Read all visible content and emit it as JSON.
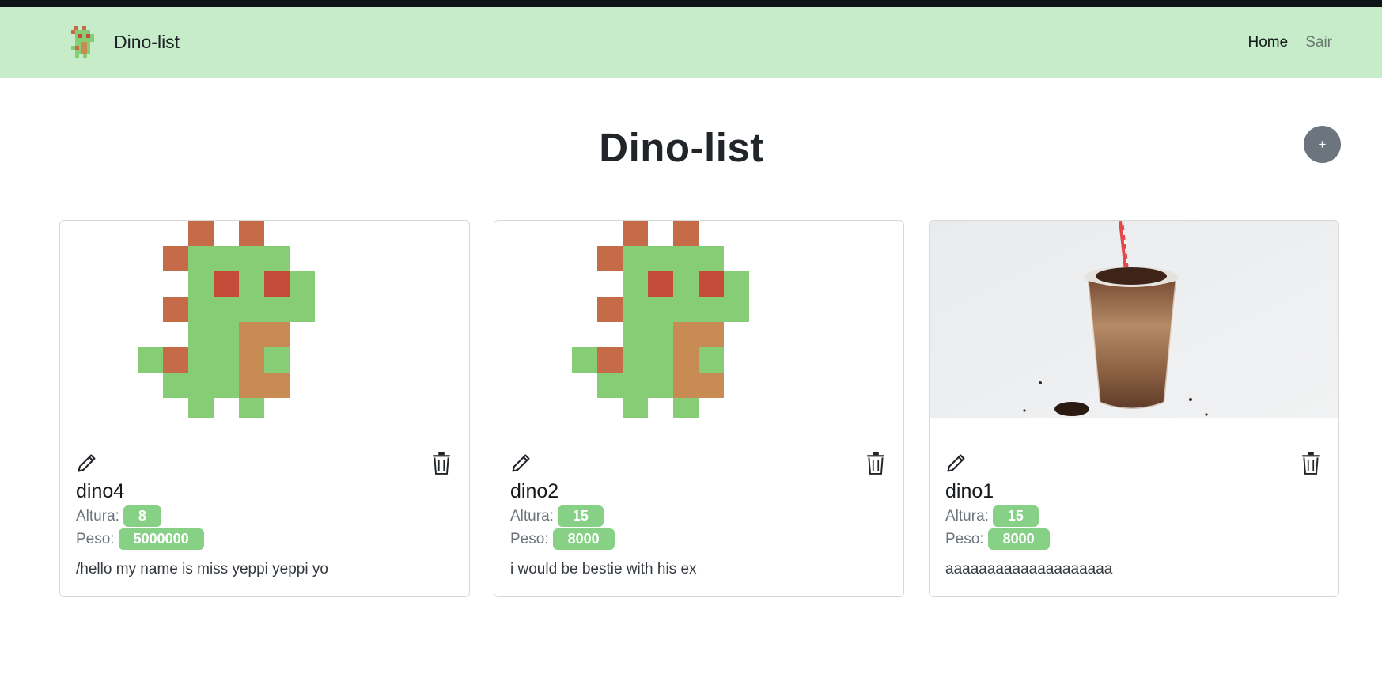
{
  "navbar": {
    "brand": "Dino-list",
    "links": [
      "Home",
      "Sair"
    ]
  },
  "page": {
    "title": "Dino-list",
    "add_label": "+"
  },
  "labels": {
    "altura": "Altura:",
    "peso": "Peso:"
  },
  "cards": [
    {
      "name": "dino4",
      "altura": "8",
      "peso": "5000000",
      "description": "/hello my name is miss yeppi yeppi yo",
      "image": "pixel-dino"
    },
    {
      "name": "dino2",
      "altura": "15",
      "peso": "8000",
      "description": "i would be bestie with his ex",
      "image": "pixel-dino"
    },
    {
      "name": "dino1",
      "altura": "15",
      "peso": "8000",
      "description": "aaaaaaaaaaaaaaaaaaaa",
      "image": "chocolate-milkshake-photo"
    }
  ],
  "colors": {
    "navbar": "#c6ecca",
    "badge": "#86d185",
    "dino_green": "#86cd76",
    "dino_brown": "#c66b48",
    "dino_belly": "#c98b54",
    "add_button": "#6c757d"
  }
}
